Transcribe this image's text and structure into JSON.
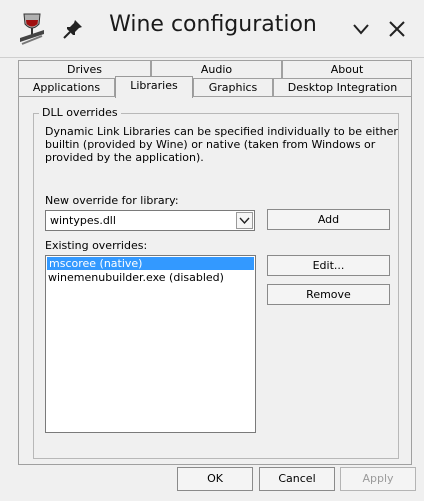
{
  "window": {
    "title": "Wine configuration"
  },
  "tabs": {
    "row1": [
      "Drives",
      "Audio",
      "About"
    ],
    "row2": [
      "Applications",
      "Libraries",
      "Graphics",
      "Desktop Integration"
    ],
    "active": "Libraries"
  },
  "dll_overrides": {
    "group_title": "DLL overrides",
    "description_lines": [
      "Dynamic Link Libraries can be specified individually to be either",
      "builtin (provided by Wine) or native (taken from Windows or",
      "provided by the application)."
    ],
    "new_override_label": "New override for library:",
    "new_override_value": "wintypes.dll",
    "add_label": "Add",
    "existing_label": "Existing overrides:",
    "existing_overrides": [
      {
        "text": "mscoree (native)",
        "selected": true
      },
      {
        "text": "winemenubuilder.exe (disabled)",
        "selected": false
      }
    ],
    "edit_label": "Edit...",
    "remove_label": "Remove"
  },
  "footer": {
    "ok_label": "OK",
    "cancel_label": "Cancel",
    "apply_label": "Apply"
  },
  "colors": {
    "selection": "#3399ff",
    "window_bg": "#f0f0f0"
  },
  "icons": [
    "wine-glass-icon",
    "pin-icon",
    "chevron-down-icon",
    "close-icon",
    "combo-arrow-icon"
  ]
}
